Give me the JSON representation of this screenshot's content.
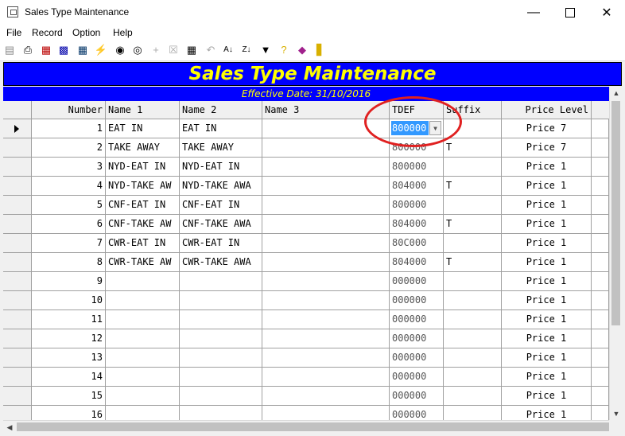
{
  "window": {
    "title": "Sales Type Maintenance"
  },
  "menu": [
    "File",
    "Record",
    "Option",
    "Help"
  ],
  "toolbar": [
    "print-preview-icon",
    "print-icon",
    "report-icon",
    "chart-icon",
    "table-icon",
    "lightning-icon",
    "binoculars-icon",
    "find-icon",
    "add-icon",
    "delete-icon",
    "undo-icon",
    "sort-ascending-icon",
    "sort-descending-icon",
    "filter-icon",
    "help-icon",
    "eraser-icon",
    "exit-icon"
  ],
  "banner": {
    "title": "Sales Type Maintenance",
    "subtitle": "Effective Date: 31/10/2016"
  },
  "columns": [
    "Number",
    "Name 1",
    "Name 2",
    "Name 3",
    "TDEF",
    "Suffix",
    "Price Level"
  ],
  "rows": [
    {
      "number": "1",
      "name1": "EAT IN",
      "name2": "EAT IN",
      "name3": "",
      "tdef": "800000",
      "suffix": "",
      "price_level": "Price  7"
    },
    {
      "number": "2",
      "name1": "TAKE AWAY",
      "name2": "TAKE AWAY",
      "name3": "",
      "tdef": "800000",
      "suffix": "T",
      "price_level": "Price  7"
    },
    {
      "number": "3",
      "name1": "NYD-EAT IN",
      "name2": "NYD-EAT IN",
      "name3": "",
      "tdef": "800000",
      "suffix": "",
      "price_level": "Price  1"
    },
    {
      "number": "4",
      "name1": "NYD-TAKE AW",
      "name2": "NYD-TAKE AWA",
      "name3": "",
      "tdef": "804000",
      "suffix": "T",
      "price_level": "Price  1"
    },
    {
      "number": "5",
      "name1": "CNF-EAT IN",
      "name2": "CNF-EAT IN",
      "name3": "",
      "tdef": "800000",
      "suffix": "",
      "price_level": "Price  1"
    },
    {
      "number": "6",
      "name1": "CNF-TAKE AW",
      "name2": "CNF-TAKE AWA",
      "name3": "",
      "tdef": "804000",
      "suffix": "T",
      "price_level": "Price  1"
    },
    {
      "number": "7",
      "name1": "CWR-EAT IN",
      "name2": "CWR-EAT IN",
      "name3": "",
      "tdef": "80C000",
      "suffix": "",
      "price_level": "Price  1"
    },
    {
      "number": "8",
      "name1": "CWR-TAKE AW",
      "name2": "CWR-TAKE AWA",
      "name3": "",
      "tdef": "804000",
      "suffix": "T",
      "price_level": "Price  1"
    },
    {
      "number": "9",
      "name1": "",
      "name2": "",
      "name3": "",
      "tdef": "000000",
      "suffix": "",
      "price_level": "Price  1"
    },
    {
      "number": "10",
      "name1": "",
      "name2": "",
      "name3": "",
      "tdef": "000000",
      "suffix": "",
      "price_level": "Price  1"
    },
    {
      "number": "11",
      "name1": "",
      "name2": "",
      "name3": "",
      "tdef": "000000",
      "suffix": "",
      "price_level": "Price  1"
    },
    {
      "number": "12",
      "name1": "",
      "name2": "",
      "name3": "",
      "tdef": "000000",
      "suffix": "",
      "price_level": "Price  1"
    },
    {
      "number": "13",
      "name1": "",
      "name2": "",
      "name3": "",
      "tdef": "000000",
      "suffix": "",
      "price_level": "Price  1"
    },
    {
      "number": "14",
      "name1": "",
      "name2": "",
      "name3": "",
      "tdef": "000000",
      "suffix": "",
      "price_level": "Price  1"
    },
    {
      "number": "15",
      "name1": "",
      "name2": "",
      "name3": "",
      "tdef": "000000",
      "suffix": "",
      "price_level": "Price  1"
    },
    {
      "number": "16",
      "name1": "",
      "name2": "",
      "name3": "",
      "tdef": "000000",
      "suffix": "",
      "price_level": "Price  1"
    }
  ],
  "active_row": 1
}
